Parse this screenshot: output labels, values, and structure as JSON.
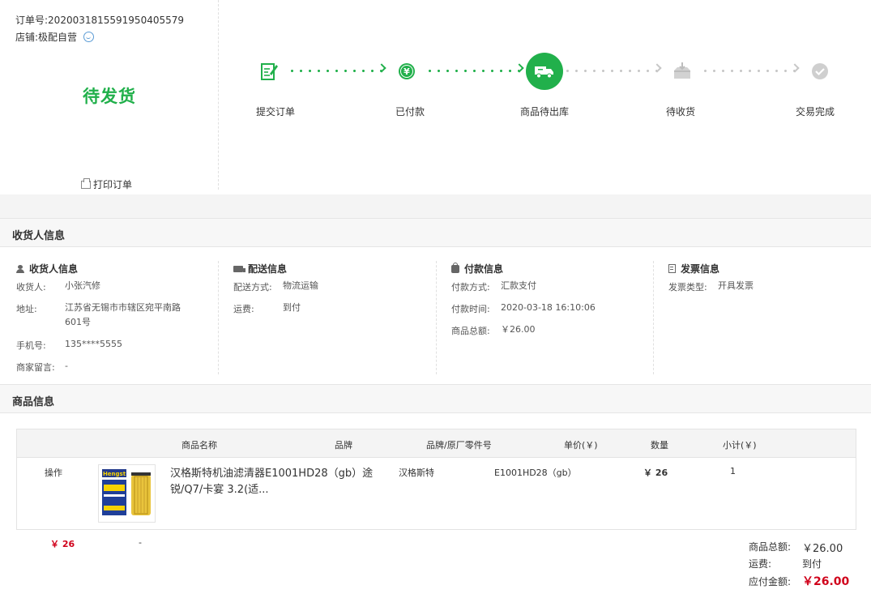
{
  "order": {
    "number_label": "订单号:",
    "number": "20200318155919504055 79",
    "shop_label": "店铺:",
    "shop": "极配自营",
    "status": "待发货",
    "print": "打印订单"
  },
  "steps": [
    {
      "label": "提交订单",
      "state": "done",
      "icon": "form-edit-icon"
    },
    {
      "label": "已付款",
      "state": "done",
      "icon": "yen-icon"
    },
    {
      "label": "商品待出库",
      "state": "current",
      "icon": "truck-icon"
    },
    {
      "label": "待收货",
      "state": "pending",
      "icon": "inbox-icon"
    },
    {
      "label": "交易完成",
      "state": "pending",
      "icon": "check-icon"
    }
  ],
  "consignee_section": "收货人信息",
  "columns": {
    "consignee": {
      "title": "收货人信息",
      "name_label": "收货人:",
      "name": "小张汽修",
      "addr_label": "地址:",
      "addr1": "江苏省无锡市市辖区宛平南路",
      "addr2": "601号",
      "phone_label": "手机号:",
      "phone": "135****5555",
      "note_label": "商家留言:",
      "note": "-"
    },
    "delivery": {
      "title": "配送信息",
      "method_label": "配送方式:",
      "method": "物流运输",
      "fee_label": "运费:",
      "fee": "到付"
    },
    "payment": {
      "title": "付款信息",
      "method_label": "付款方式:",
      "method": "汇款支付",
      "time_label": "付款时间:",
      "time": "2020-03-18 16:10:06",
      "total_label": "商品总额:",
      "total": "￥26.00"
    },
    "invoice": {
      "title": "发票信息",
      "type_label": "发票类型:",
      "type": "开具发票"
    }
  },
  "goods_section": "商品信息",
  "table": {
    "headers": [
      "商品名称",
      "品牌",
      "品牌/原厂零件号",
      "单价(￥)",
      "数量",
      "小计(￥)"
    ],
    "row": {
      "op": "操作",
      "name": "汉格斯特机油滤清器E1001HD28（gb）途锐/Q7/卡宴 3.2(适...",
      "brand": "汉格斯特",
      "part_no": "E1001HD28（gb）",
      "price": "￥ 26",
      "qty": "1",
      "subtotal": "￥ 26",
      "dash": "-",
      "img_brand": "Hengst"
    }
  },
  "summary": {
    "goods_total_label": "商品总额:",
    "goods_total": "￥26.00",
    "shipping_label": "运费:",
    "shipping": "到付",
    "payable_label": "应付金额:",
    "payable": "￥26.00"
  },
  "colors": {
    "accent": "#21b04b",
    "pending": "#c7c7c7",
    "price": "#d0021b"
  }
}
